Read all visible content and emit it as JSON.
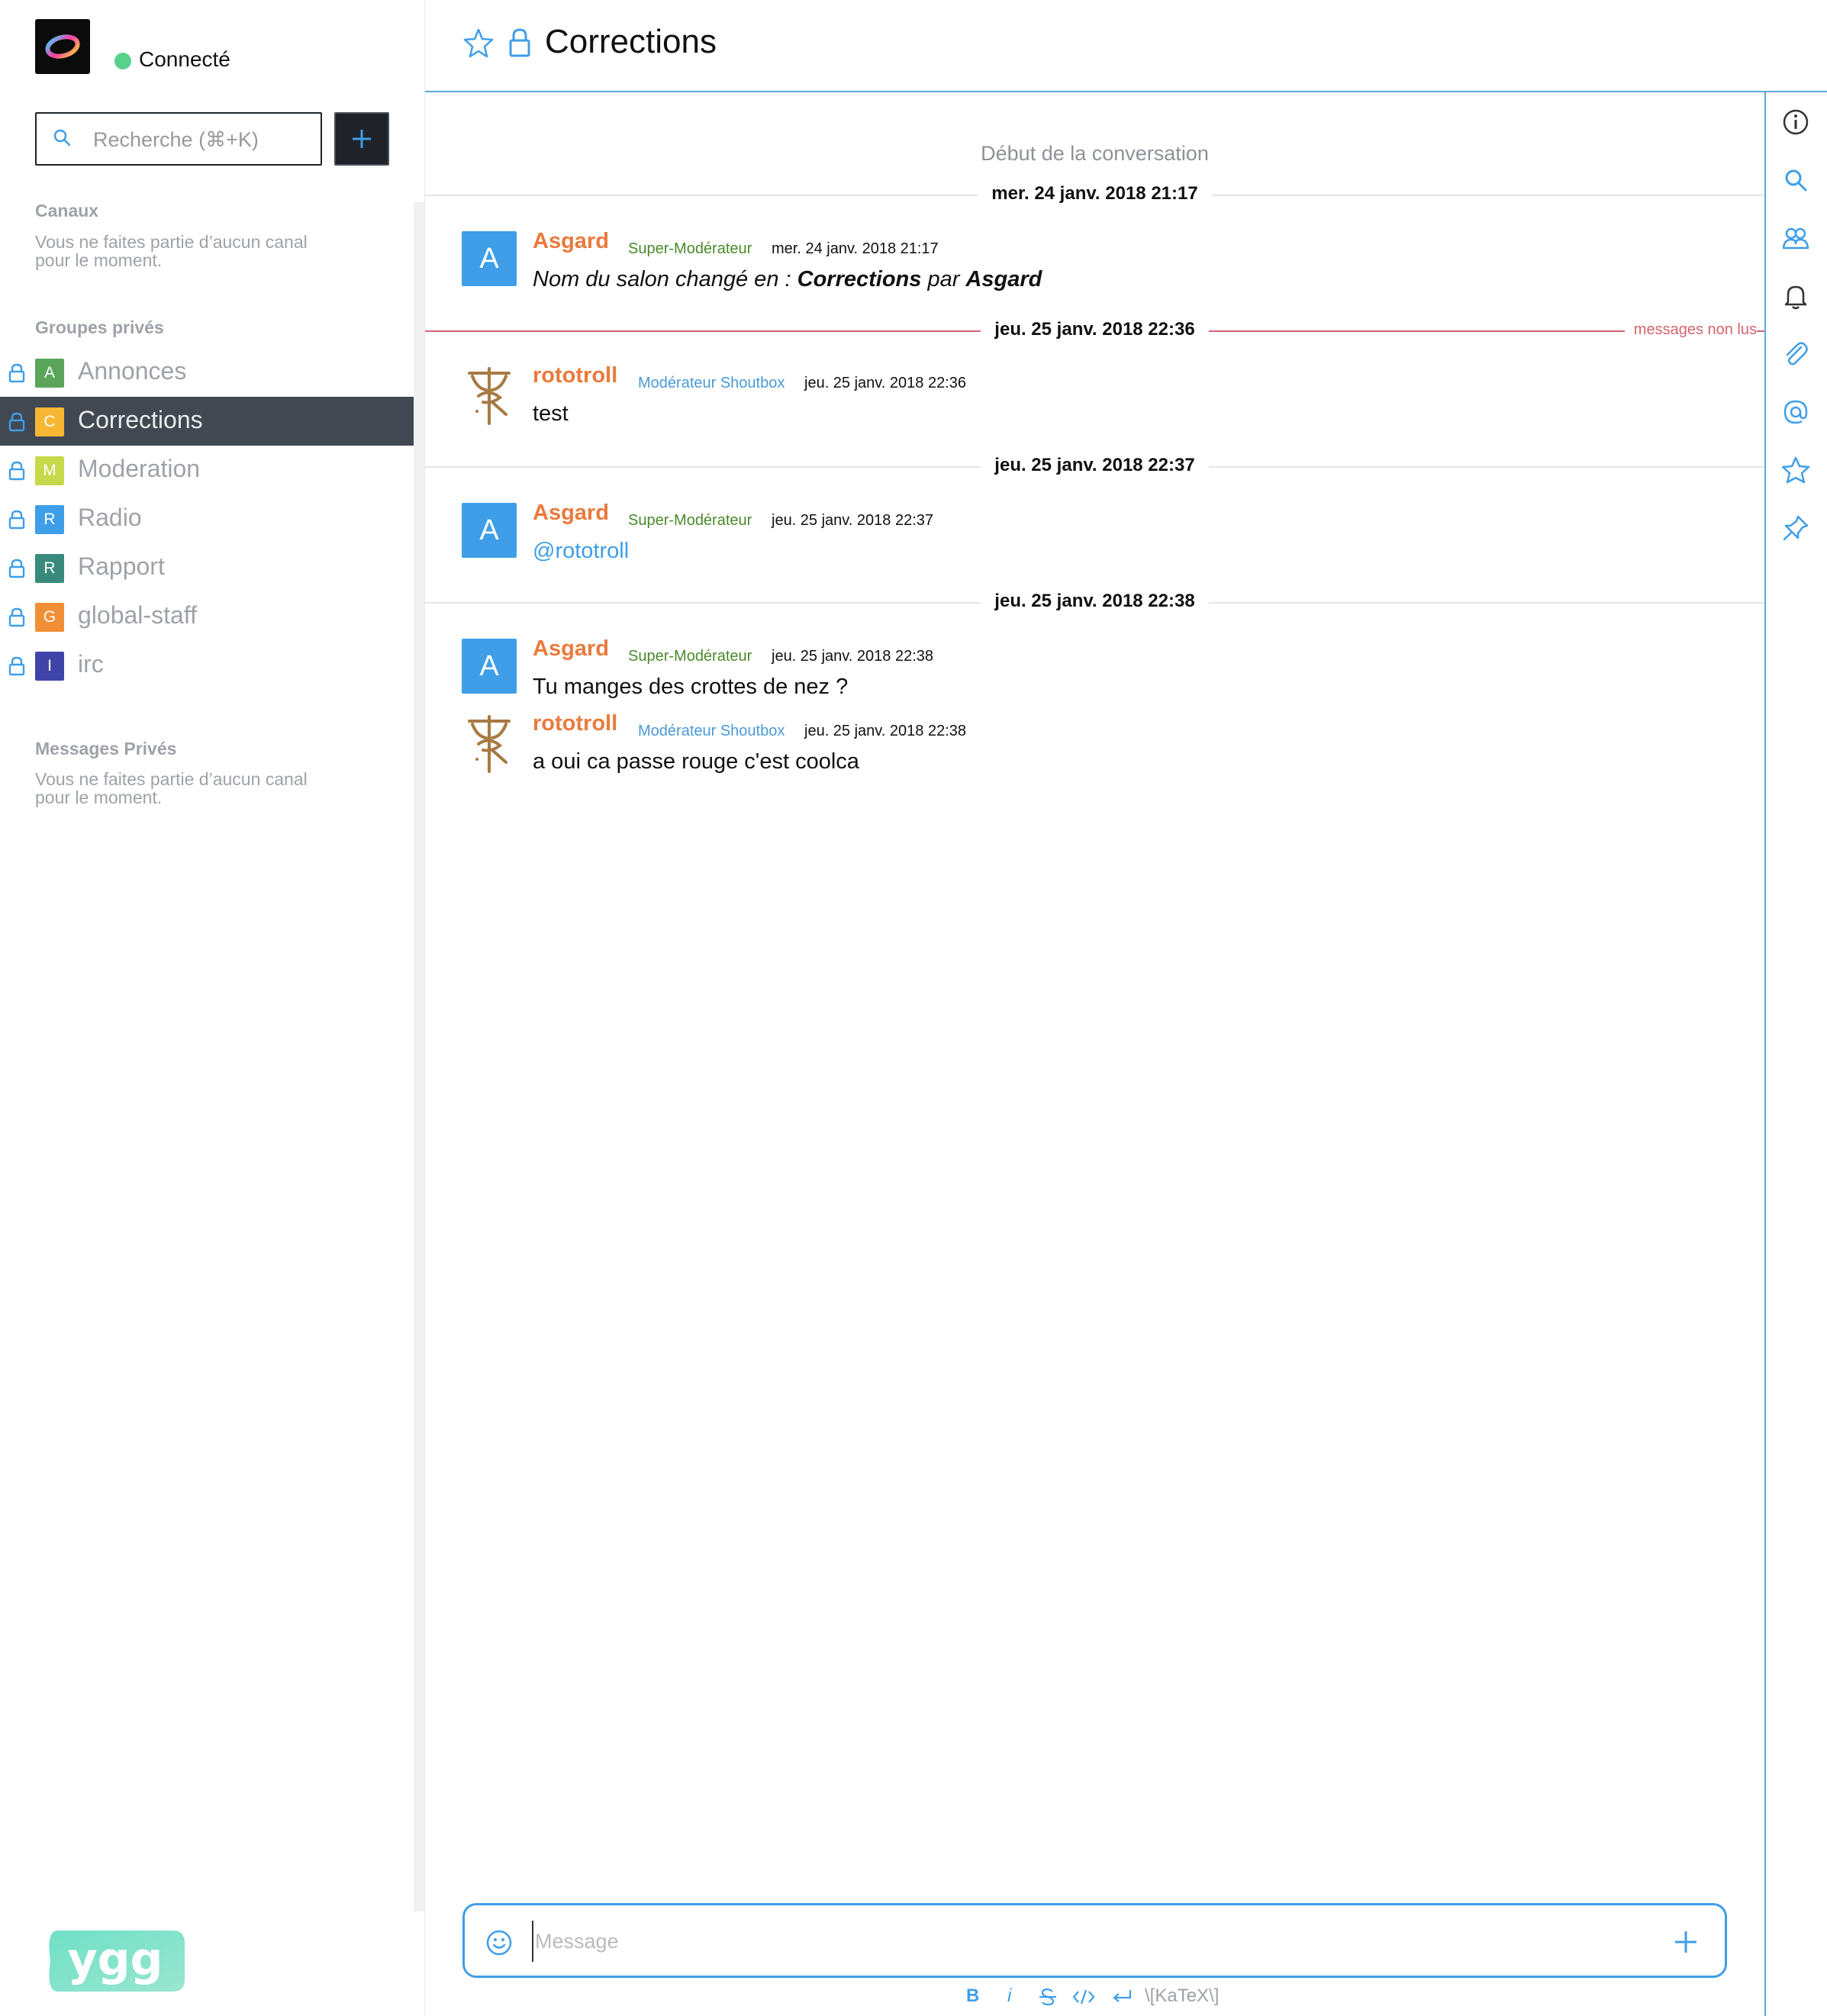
{
  "sidebar": {
    "status": "Connecté",
    "search_placeholder": "Recherche (⌘+K)",
    "channels_title": "Canaux",
    "channels_empty_1": "Vous ne faites partie d’aucun canal",
    "channels_empty_2": "pour le moment.",
    "private_groups_title": "Groupes privés",
    "rooms": [
      {
        "initial": "A",
        "name": "Annonces",
        "color": "#5aa55a"
      },
      {
        "initial": "C",
        "name": "Corrections",
        "color": "#f7b733",
        "active": true
      },
      {
        "initial": "M",
        "name": "Moderation",
        "color": "#c5d94b"
      },
      {
        "initial": "R",
        "name": "Radio",
        "color": "#3f9ee8"
      },
      {
        "initial": "R",
        "name": "Rapport",
        "color": "#3a8a7c"
      },
      {
        "initial": "G",
        "name": "global-staff",
        "color": "#f08f35"
      },
      {
        "initial": "I",
        "name": "irc",
        "color": "#3f45a8"
      }
    ],
    "dm_title": "Messages Privés",
    "dm_empty_1": "Vous ne faites partie d’aucun canal",
    "dm_empty_2": "pour le moment.",
    "bottom_logo_text": "ygg"
  },
  "header": {
    "title": "Corrections"
  },
  "messages": {
    "conversation_start": "Début de la conversation",
    "unread_label": "messages non lus",
    "days": [
      "mer. 24 janv. 2018 21:17",
      "jeu. 25 janv. 2018 22:36",
      "jeu. 25 janv. 2018 22:37",
      "jeu. 25 janv. 2018 22:38"
    ],
    "items": [
      {
        "avatar": "A",
        "user": "Asgard",
        "role": "Super-Modérateur",
        "time": "mer. 24 janv. 2018 21:17",
        "body_prefix": "Nom du salon changé en : ",
        "body_room": "Corrections",
        "body_mid": " par ",
        "body_user": "Asgard"
      },
      {
        "avatar": "logo",
        "user": "rototroll",
        "role": "Modérateur Shoutbox",
        "time": "jeu. 25 janv. 2018 22:36",
        "body": "test"
      },
      {
        "avatar": "A",
        "user": "Asgard",
        "role": "Super-Modérateur",
        "time": "jeu. 25 janv. 2018 22:37",
        "body": "@rototroll"
      },
      {
        "avatar": "A",
        "user": "Asgard",
        "role": "Super-Modérateur",
        "time": "jeu. 25 janv. 2018 22:38",
        "body": "Tu manges des crottes de nez ?"
      },
      {
        "avatar": "logo",
        "user": "rototroll",
        "role": "Modérateur Shoutbox",
        "time": "jeu. 25 janv. 2018 22:38",
        "body": "a oui ca passe rouge c'est coolca"
      }
    ]
  },
  "composer": {
    "placeholder": "Message",
    "format_bold": "B",
    "format_italic": "i",
    "format_katex": "\\[KaTeX\\]"
  },
  "colors": {
    "accent": "#3f9ee8",
    "username": "#ea7a3c",
    "online": "#57d28c",
    "unread": "#d5636f",
    "sidebar_active": "#414852"
  }
}
